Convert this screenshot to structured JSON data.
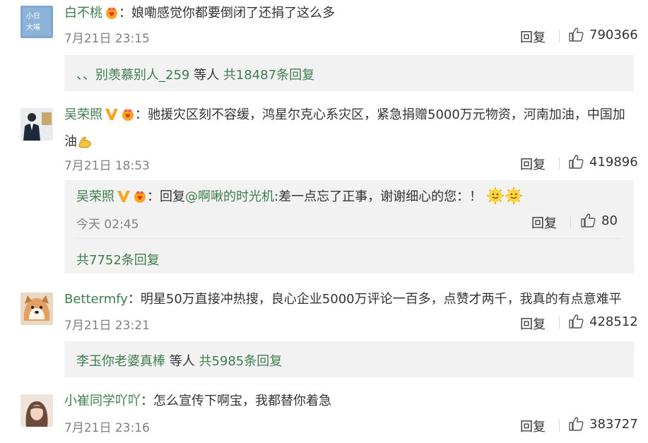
{
  "colors": {
    "username": "#3e7d4f",
    "text": "#333333",
    "meta": "#808080",
    "panel": "#f2f2f2"
  },
  "comments": [
    {
      "user": "白不桃",
      "text": "娘嘞感觉你都要倒闭了还捐了这么多",
      "time": "7月21日 23:15",
      "reply_label": "回复",
      "likes": "790366",
      "summary": {
        "prefix": "、、别羡慕别人_259",
        "mid": " 等人 ",
        "count": "共18487条回复"
      }
    },
    {
      "user": "吴荣照",
      "text": "驰援灾区刻不容缓，鸿星尔克心系灾区，紧急捐赠5000万元物资，河南加油，中国加油",
      "time": "7月21日 18:53",
      "reply_label": "回复",
      "likes": "419896",
      "reply": {
        "user": "吴荣照",
        "prefix": "回复",
        "mention": "@啊啾的时光机",
        "text": ":差一点忘了正事，谢谢细心的您：！",
        "time": "今天 02:45",
        "reply_label": "回复",
        "likes": "80"
      },
      "summary_total": "共7752条回复"
    },
    {
      "user": "Bettermfy",
      "text": "明星50万直接冲热搜，良心企业5000万评论一百多，点赞才两千，我真的有点意难平",
      "time": "7月21日 23:21",
      "reply_label": "回复",
      "likes": "428512",
      "summary": {
        "prefix": "李玉你老婆真棒",
        "mid": " 等人 ",
        "count": "共5985条回复"
      }
    },
    {
      "user": "小崔同学吖吖",
      "text": "怎么宣传下啊宝，我都替你着急",
      "time": "7月21日 23:16",
      "reply_label": "回复",
      "likes": "383727"
    }
  ],
  "avatar_texts": [
    "小日",
    "大嘴"
  ],
  "icons": {
    "like": "thumbs-up-icon",
    "verified": "v-badge-icon",
    "member": "crown-heart-icon",
    "emoji_smile": "smile-emoji-icon",
    "emoji_flex": "flexed-biceps-icon"
  }
}
